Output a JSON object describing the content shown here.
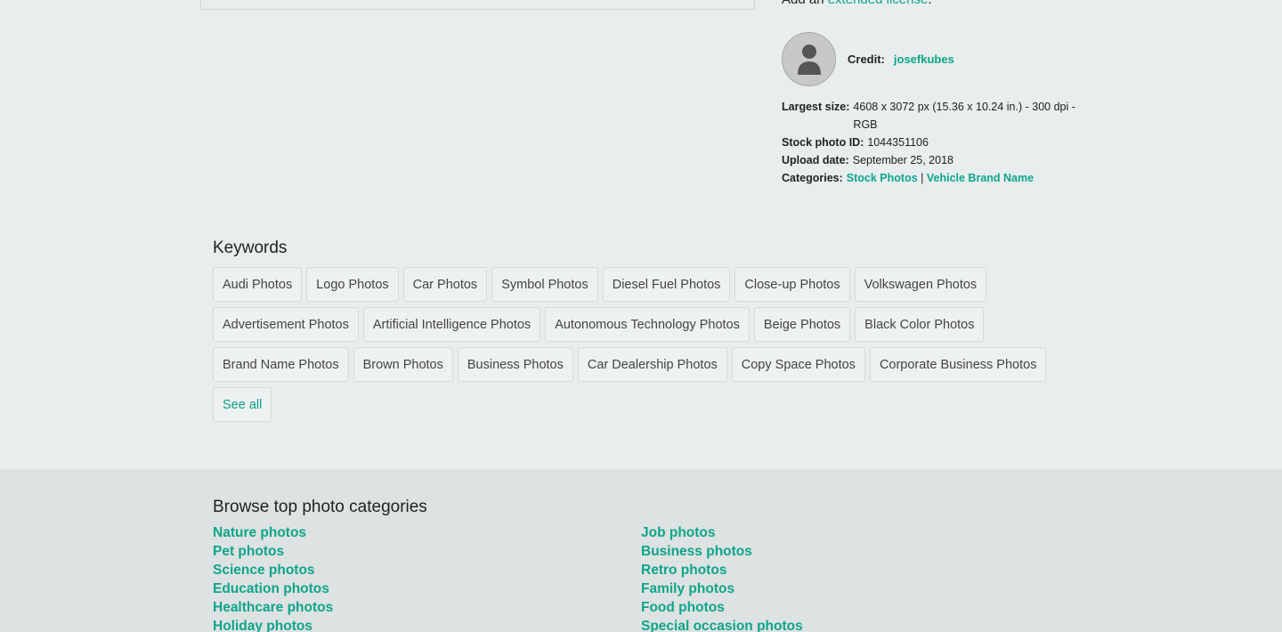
{
  "license": {
    "prefix": "Add an",
    "link": "extended license",
    "suffix": "."
  },
  "credit": {
    "label": "Credit:",
    "author": "josefkubes",
    "avatar_icon": "user-avatar-icon"
  },
  "details": {
    "largest_size_label": "Largest size:",
    "largest_size_value": "4608 x 3072 px (15.36 x 10.24 in.) - 300 dpi - RGB",
    "stock_id_label": "Stock photo ID:",
    "stock_id_value": "1044351106",
    "upload_date_label": "Upload date:",
    "upload_date_value": "September 25, 2018",
    "categories_label": "Categories:",
    "categories": [
      "Stock Photos",
      "Vehicle Brand Name"
    ],
    "categories_separator": "|"
  },
  "keywords": {
    "title": "Keywords",
    "rows": [
      [
        "Audi Photos",
        "Logo Photos",
        "Car Photos",
        "Symbol Photos",
        "Diesel Fuel Photos",
        "Close-up Photos",
        "Volkswagen Photos"
      ],
      [
        "Advertisement Photos",
        "Artificial Intelligence Photos",
        "Autonomous Technology Photos",
        "Beige Photos",
        "Black Color Photos"
      ],
      [
        "Brand Name Photos",
        "Brown Photos",
        "Business Photos",
        "Car Dealership Photos",
        "Copy Space Photos",
        "Corporate Business Photos"
      ]
    ],
    "see_all": "See all"
  },
  "browse": {
    "title": "Browse top photo categories",
    "left": [
      "Nature photos",
      "Pet photos",
      "Science photos",
      "Education photos",
      "Healthcare photos",
      "Holiday photos"
    ],
    "right": [
      "Job photos",
      "Business photos",
      "Retro photos",
      "Family photos",
      "Food photos",
      "Special occasion photos"
    ]
  },
  "colors": {
    "accent": "#0ea58a",
    "background": "#e8eded",
    "browse_background": "#dde2e2"
  }
}
